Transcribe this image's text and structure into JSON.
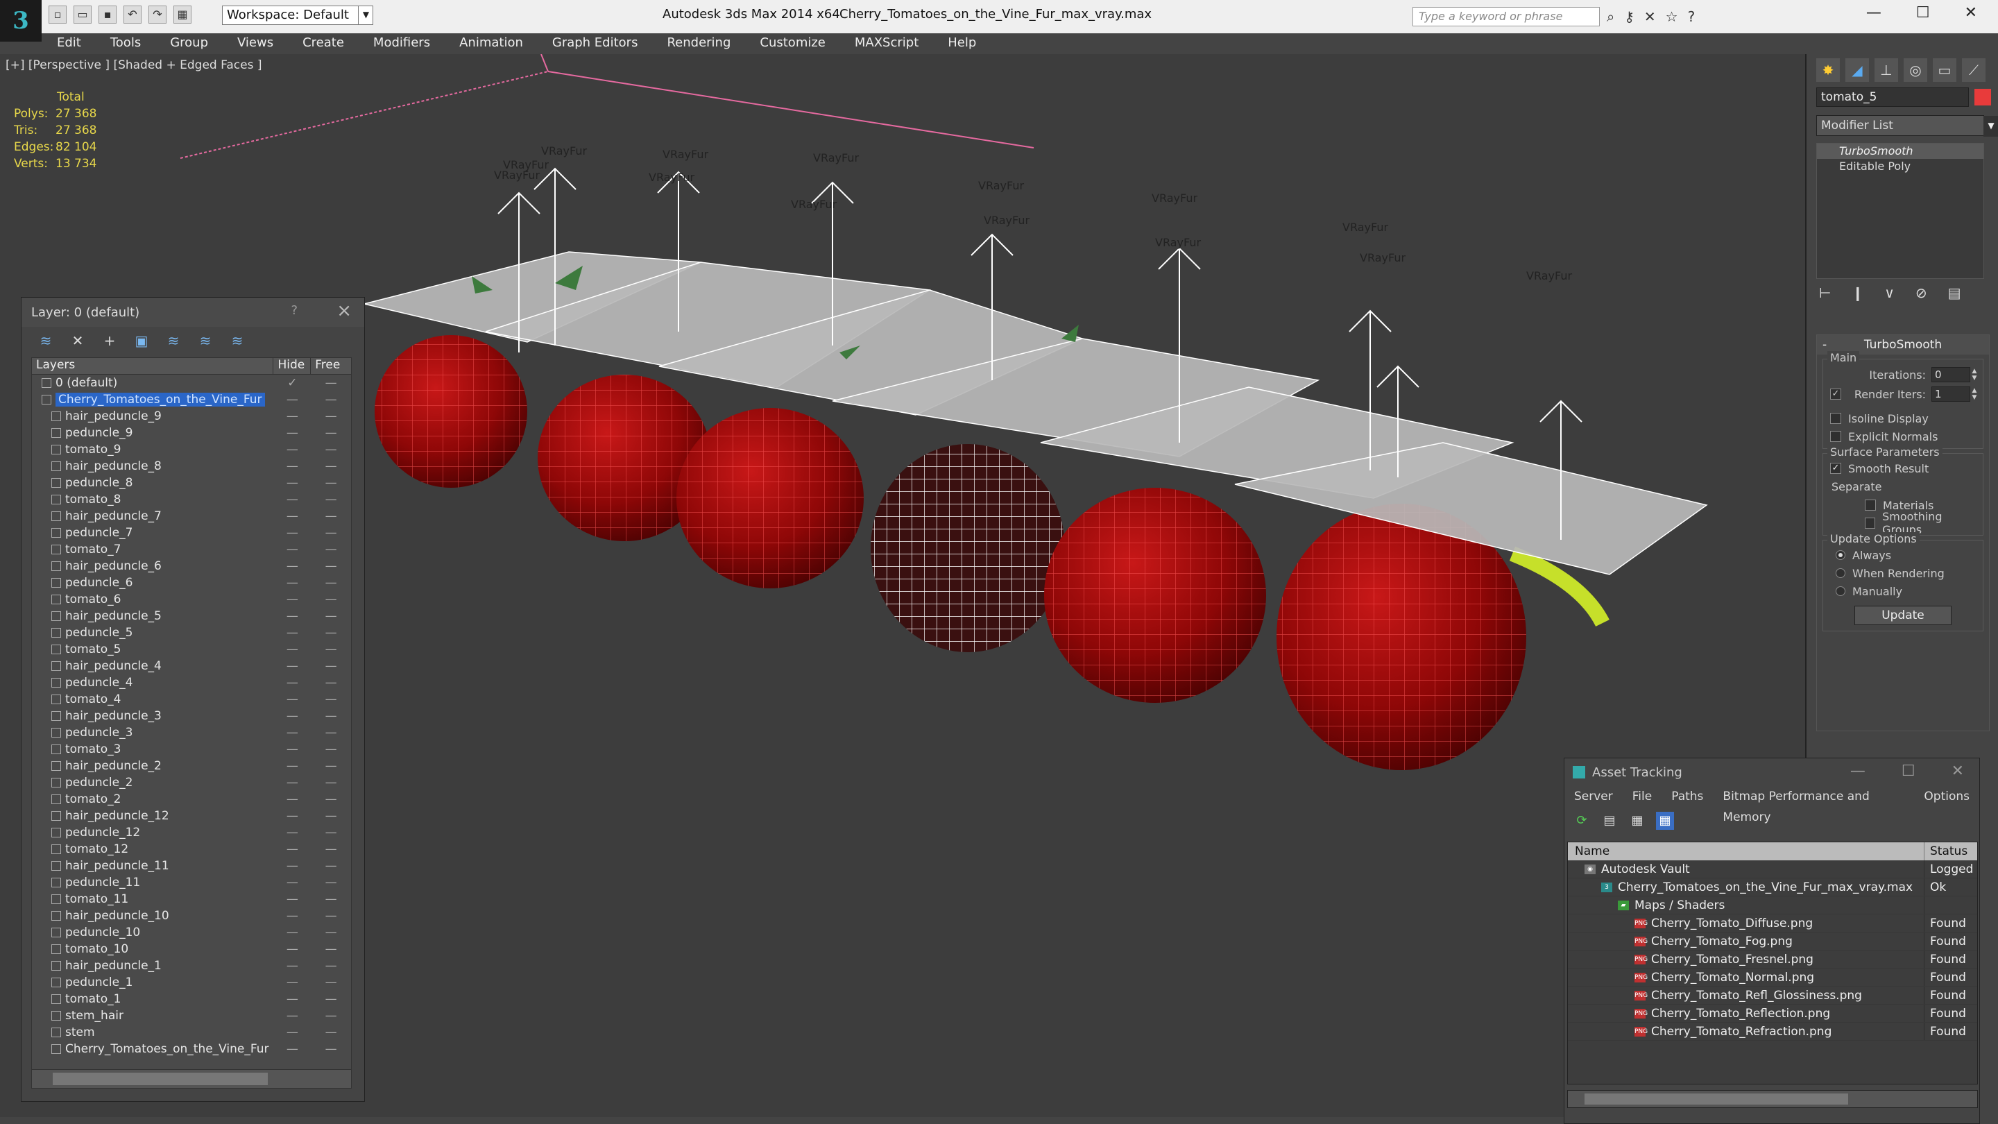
{
  "title_bar": {
    "workspace": "Workspace: Default",
    "app_title": "Autodesk 3ds Max  2014 x64",
    "file_name": "Cherry_Tomatoes_on_the_Vine_Fur_max_vray.max",
    "search_placeholder": "Type a keyword or phrase"
  },
  "menu": [
    "Edit",
    "Tools",
    "Group",
    "Views",
    "Create",
    "Modifiers",
    "Animation",
    "Graph Editors",
    "Rendering",
    "Customize",
    "MAXScript",
    "Help"
  ],
  "viewport": {
    "label": "[+] [Perspective ] [Shaded + Edged Faces ]",
    "stats_header": "Total",
    "stats": [
      {
        "label": "Polys:",
        "value": "27 368"
      },
      {
        "label": "Tris:",
        "value": "27 368"
      },
      {
        "label": "Edges:",
        "value": "82 104"
      },
      {
        "label": "Verts:",
        "value": "13 734"
      }
    ],
    "fur_label": "VRayFur"
  },
  "layer_window": {
    "title": "Layer: 0 (default)",
    "help": "?",
    "col_layers": "Layers",
    "col_hide": "Hide",
    "col_freeze": "Free",
    "rows": [
      {
        "name": "0 (default)",
        "level": 1,
        "check": "✓"
      },
      {
        "name": "Cherry_Tomatoes_on_the_Vine_Fur",
        "level": 1,
        "selected": true
      },
      {
        "name": "hair_peduncle_9",
        "level": 2
      },
      {
        "name": "peduncle_9",
        "level": 2
      },
      {
        "name": "tomato_9",
        "level": 2
      },
      {
        "name": "hair_peduncle_8",
        "level": 2
      },
      {
        "name": "peduncle_8",
        "level": 2
      },
      {
        "name": "tomato_8",
        "level": 2
      },
      {
        "name": "hair_peduncle_7",
        "level": 2
      },
      {
        "name": "peduncle_7",
        "level": 2
      },
      {
        "name": "tomato_7",
        "level": 2
      },
      {
        "name": "hair_peduncle_6",
        "level": 2
      },
      {
        "name": "peduncle_6",
        "level": 2
      },
      {
        "name": "tomato_6",
        "level": 2
      },
      {
        "name": "hair_peduncle_5",
        "level": 2
      },
      {
        "name": "peduncle_5",
        "level": 2
      },
      {
        "name": "tomato_5",
        "level": 2
      },
      {
        "name": "hair_peduncle_4",
        "level": 2
      },
      {
        "name": "peduncle_4",
        "level": 2
      },
      {
        "name": "tomato_4",
        "level": 2
      },
      {
        "name": "hair_peduncle_3",
        "level": 2
      },
      {
        "name": "peduncle_3",
        "level": 2
      },
      {
        "name": "tomato_3",
        "level": 2
      },
      {
        "name": "hair_peduncle_2",
        "level": 2
      },
      {
        "name": "peduncle_2",
        "level": 2
      },
      {
        "name": "tomato_2",
        "level": 2
      },
      {
        "name": "hair_peduncle_12",
        "level": 2
      },
      {
        "name": "peduncle_12",
        "level": 2
      },
      {
        "name": "tomato_12",
        "level": 2
      },
      {
        "name": "hair_peduncle_11",
        "level": 2
      },
      {
        "name": "peduncle_11",
        "level": 2
      },
      {
        "name": "tomato_11",
        "level": 2
      },
      {
        "name": "hair_peduncle_10",
        "level": 2
      },
      {
        "name": "peduncle_10",
        "level": 2
      },
      {
        "name": "tomato_10",
        "level": 2
      },
      {
        "name": "hair_peduncle_1",
        "level": 2
      },
      {
        "name": "peduncle_1",
        "level": 2
      },
      {
        "name": "tomato_1",
        "level": 2
      },
      {
        "name": "stem_hair",
        "level": 2
      },
      {
        "name": "stem",
        "level": 2
      },
      {
        "name": "Cherry_Tomatoes_on_the_Vine_Fur",
        "level": 2
      }
    ]
  },
  "command_panel": {
    "object_name": "tomato_5",
    "object_color": "#e83b3b",
    "modifier_list": "Modifier List",
    "stack": [
      "TurboSmooth",
      "Editable Poly"
    ],
    "rollout_title": "TurboSmooth",
    "main_group": "Main",
    "iterations_label": "Iterations:",
    "iterations_value": "0",
    "render_iters_label": "Render Iters:",
    "render_iters_value": "1",
    "render_iters_checked": "✓",
    "isoline": "Isoline Display",
    "explicit_normals": "Explicit Normals",
    "surface_group": "Surface Parameters",
    "smooth_result": "Smooth Result",
    "smooth_checked": "✓",
    "separate": "Separate",
    "materials": "Materials",
    "smoothing_groups": "Smoothing Groups",
    "update_group": "Update Options",
    "always": "Always",
    "when_rendering": "When Rendering",
    "manually": "Manually",
    "update_button": "Update"
  },
  "asset_tracking": {
    "title": "Asset Tracking",
    "menu": [
      "Server",
      "File",
      "Paths",
      "Bitmap Performance and Memory",
      "Options"
    ],
    "col_name": "Name",
    "col_status": "Status",
    "rows": [
      {
        "name": "Autodesk Vault",
        "status": "Logged",
        "indent": 1,
        "icon": "vault"
      },
      {
        "name": "Cherry_Tomatoes_on_the_Vine_Fur_max_vray.max",
        "status": "Ok",
        "indent": 2,
        "icon": "max"
      },
      {
        "name": "Maps / Shaders",
        "status": "",
        "indent": 3,
        "icon": "folder"
      },
      {
        "name": "Cherry_Tomato_Diffuse.png",
        "status": "Found",
        "indent": 4,
        "icon": "png"
      },
      {
        "name": "Cherry_Tomato_Fog.png",
        "status": "Found",
        "indent": 4,
        "icon": "png"
      },
      {
        "name": "Cherry_Tomato_Fresnel.png",
        "status": "Found",
        "indent": 4,
        "icon": "png"
      },
      {
        "name": "Cherry_Tomato_Normal.png",
        "status": "Found",
        "indent": 4,
        "icon": "png"
      },
      {
        "name": "Cherry_Tomato_Refl_Glossiness.png",
        "status": "Found",
        "indent": 4,
        "icon": "png"
      },
      {
        "name": "Cherry_Tomato_Reflection.png",
        "status": "Found",
        "indent": 4,
        "icon": "png"
      },
      {
        "name": "Cherry_Tomato_Refraction.png",
        "status": "Found",
        "indent": 4,
        "icon": "png"
      }
    ]
  }
}
